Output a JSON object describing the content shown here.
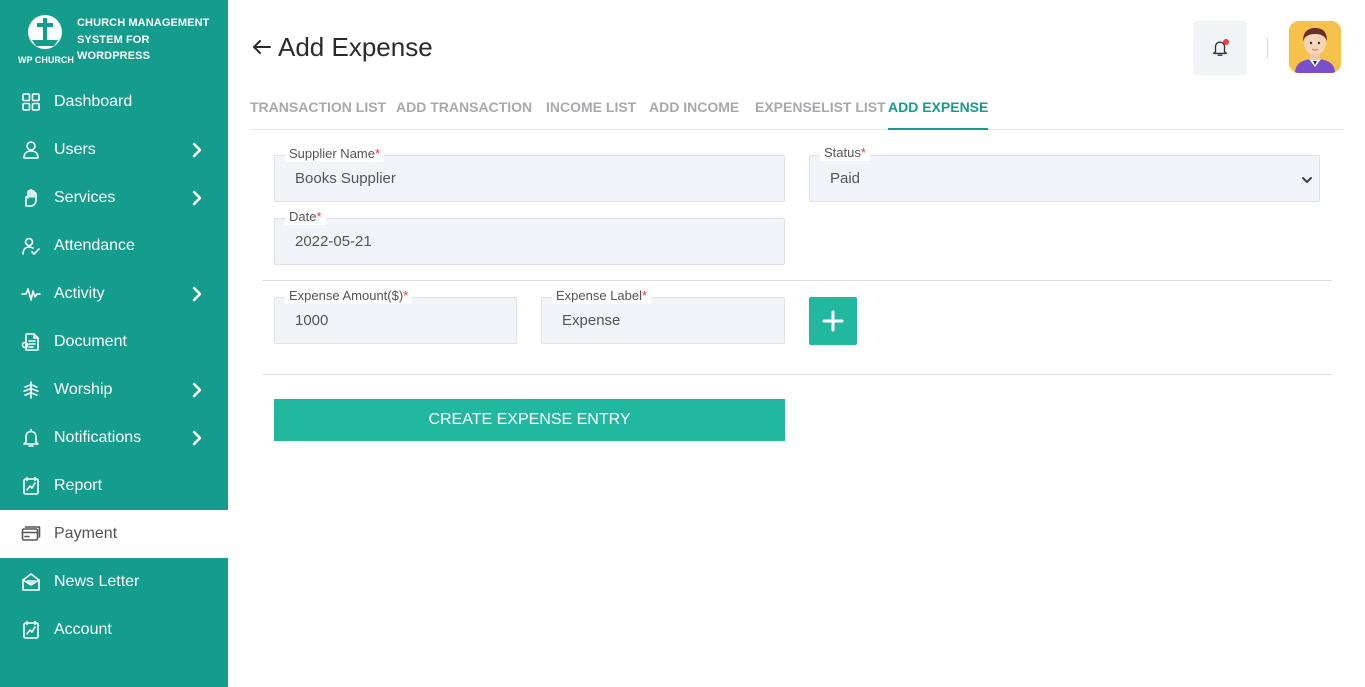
{
  "brand": {
    "logo_text": "WP CHURCH",
    "title": "CHURCH MANAGEMENT SYSTEM FOR WORDPRESS"
  },
  "sidebar": {
    "items": [
      {
        "label": "Dashboard",
        "icon": "dashboard-grid-icon",
        "has_submenu": false
      },
      {
        "label": "Users",
        "icon": "user-icon",
        "has_submenu": true
      },
      {
        "label": "Services",
        "icon": "services-hand-icon",
        "has_submenu": true
      },
      {
        "label": "Attendance",
        "icon": "attendance-user-check-icon",
        "has_submenu": false
      },
      {
        "label": "Activity",
        "icon": "activity-pulse-icon",
        "has_submenu": true
      },
      {
        "label": "Document",
        "icon": "document-icon",
        "has_submenu": false
      },
      {
        "label": "Worship",
        "icon": "worship-icon",
        "has_submenu": true
      },
      {
        "label": "Notifications",
        "icon": "bell-icon",
        "has_submenu": true
      },
      {
        "label": "Report",
        "icon": "report-icon",
        "has_submenu": false
      },
      {
        "label": "Payment",
        "icon": "payment-icon",
        "has_submenu": false,
        "active": true
      },
      {
        "label": "News Letter",
        "icon": "newsletter-envelope-icon",
        "has_submenu": false
      },
      {
        "label": "Account",
        "icon": "account-icon",
        "has_submenu": false
      }
    ]
  },
  "header": {
    "title": "Add Expense"
  },
  "tabs": [
    {
      "label": "TRANSACTION LIST",
      "active": false
    },
    {
      "label": "ADD TRANSACTION",
      "active": false
    },
    {
      "label": "INCOME LIST",
      "active": false
    },
    {
      "label": "ADD INCOME",
      "active": false
    },
    {
      "label": "EXPENSELIST LIST",
      "active": false
    },
    {
      "label": "ADD EXPENSE",
      "active": true
    }
  ],
  "form": {
    "supplier_name": {
      "label": "Supplier Name",
      "value": "Books Supplier",
      "required_mark": "*"
    },
    "status": {
      "label": "Status",
      "value": "Paid",
      "required_mark": "*"
    },
    "date": {
      "label": "Date",
      "value": "2022-05-21",
      "required_mark": "*"
    },
    "expense_amount": {
      "label": "Expense Amount($)",
      "value": "1000",
      "required_mark": "*"
    },
    "expense_label": {
      "label": "Expense Label",
      "value": "Expense",
      "required_mark": "*"
    },
    "submit_label": "CREATE EXPENSE ENTRY"
  },
  "colors": {
    "sidebar": "#149c8c",
    "accent": "#22b8a0",
    "required": "#e23a3a",
    "notification_dot": "#ef3f3f"
  }
}
